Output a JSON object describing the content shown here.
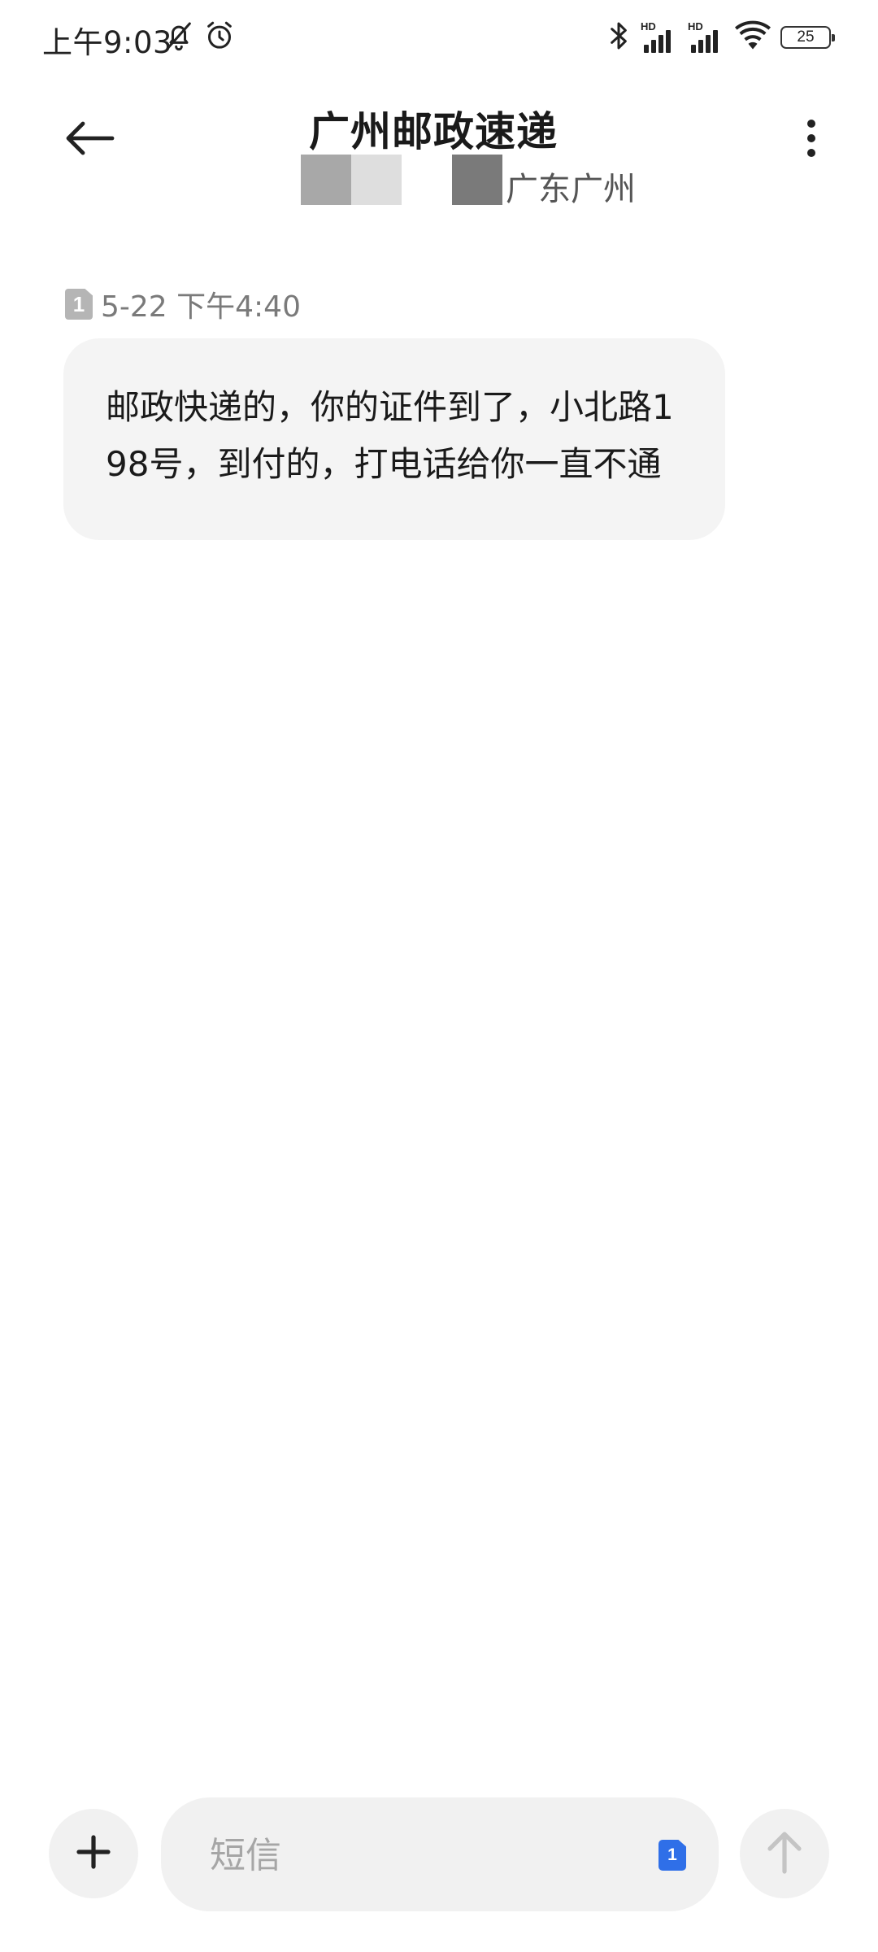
{
  "status_bar": {
    "time": "上午9:03",
    "battery_level": "25",
    "icons": [
      "bell-off-icon",
      "alarm-icon",
      "bluetooth-icon",
      "signal-hd-icon",
      "signal-hd-icon",
      "wifi-icon",
      "battery-icon"
    ]
  },
  "header": {
    "title": "广州邮政速递",
    "subtitle": "广东广州",
    "back_icon": "arrow-left-icon",
    "more_icon": "more-vertical-icon"
  },
  "thread": {
    "messages": [
      {
        "sim": "1",
        "time": "5-22 下午4:40",
        "text": "邮政快递的，你的证件到了，小北路198号，到付的，打电话给你一直不通"
      }
    ]
  },
  "compose": {
    "placeholder": "短信",
    "sim": "1",
    "add_icon": "plus-icon",
    "send_icon": "arrow-up-icon"
  },
  "colors": {
    "bubble_bg": "#f4f4f4",
    "sim_accent": "#2f6fe8",
    "sim_badge_gray": "#b5b5b5"
  }
}
